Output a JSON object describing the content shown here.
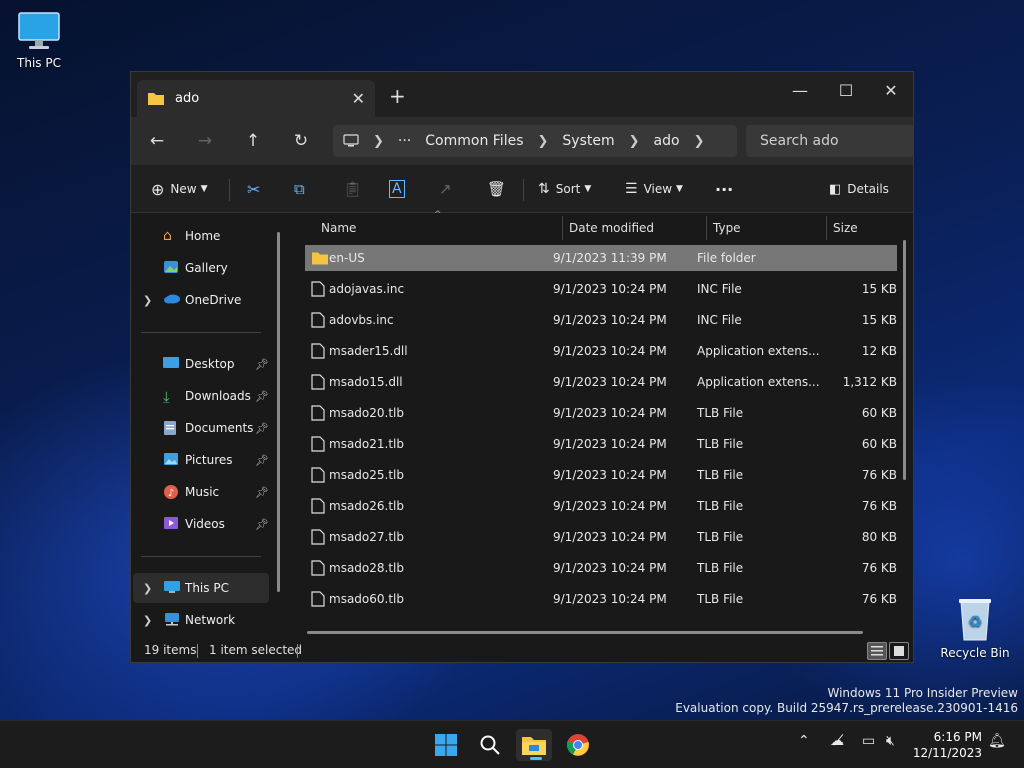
{
  "desktop": {
    "this_pc_label": "This PC",
    "recycle_bin_label": "Recycle Bin",
    "watermark_line1": "Windows 11 Pro Insider Preview",
    "watermark_line2": "Evaluation copy. Build 25947.rs_prerelease.230901-1416"
  },
  "window": {
    "tab_title": "ado",
    "new_tab_glyph": "+",
    "address": {
      "overflow": "···",
      "crumbs": [
        "Common Files",
        "System",
        "ado"
      ]
    },
    "search_placeholder": "Search ado",
    "toolbar": {
      "new_label": "New",
      "sort_label": "Sort",
      "view_label": "View",
      "more_label": "···",
      "details_label": "Details"
    },
    "sidebar": {
      "items": [
        {
          "label": "Home"
        },
        {
          "label": "Gallery"
        },
        {
          "label": "OneDrive"
        },
        {
          "label": "Desktop"
        },
        {
          "label": "Downloads"
        },
        {
          "label": "Documents"
        },
        {
          "label": "Pictures"
        },
        {
          "label": "Music"
        },
        {
          "label": "Videos"
        },
        {
          "label": "This PC"
        },
        {
          "label": "Network"
        }
      ]
    },
    "columns": {
      "name": "Name",
      "date": "Date modified",
      "type": "Type",
      "size": "Size"
    },
    "files": [
      {
        "name": "en-US",
        "date": "9/1/2023 11:39 PM",
        "type": "File folder",
        "size": ""
      },
      {
        "name": "adojavas.inc",
        "date": "9/1/2023 10:24 PM",
        "type": "INC File",
        "size": "15 KB"
      },
      {
        "name": "adovbs.inc",
        "date": "9/1/2023 10:24 PM",
        "type": "INC File",
        "size": "15 KB"
      },
      {
        "name": "msader15.dll",
        "date": "9/1/2023 10:24 PM",
        "type": "Application extens...",
        "size": "12 KB"
      },
      {
        "name": "msado15.dll",
        "date": "9/1/2023 10:24 PM",
        "type": "Application extens...",
        "size": "1,312 KB"
      },
      {
        "name": "msado20.tlb",
        "date": "9/1/2023 10:24 PM",
        "type": "TLB File",
        "size": "60 KB"
      },
      {
        "name": "msado21.tlb",
        "date": "9/1/2023 10:24 PM",
        "type": "TLB File",
        "size": "60 KB"
      },
      {
        "name": "msado25.tlb",
        "date": "9/1/2023 10:24 PM",
        "type": "TLB File",
        "size": "76 KB"
      },
      {
        "name": "msado26.tlb",
        "date": "9/1/2023 10:24 PM",
        "type": "TLB File",
        "size": "76 KB"
      },
      {
        "name": "msado27.tlb",
        "date": "9/1/2023 10:24 PM",
        "type": "TLB File",
        "size": "80 KB"
      },
      {
        "name": "msado28.tlb",
        "date": "9/1/2023 10:24 PM",
        "type": "TLB File",
        "size": "76 KB"
      },
      {
        "name": "msado60.tlb",
        "date": "9/1/2023 10:24 PM",
        "type": "TLB File",
        "size": "76 KB"
      }
    ],
    "status": {
      "count": "19 items",
      "selection": "1 item selected"
    }
  },
  "taskbar": {
    "time": "6:16 PM",
    "date": "12/11/2023"
  }
}
